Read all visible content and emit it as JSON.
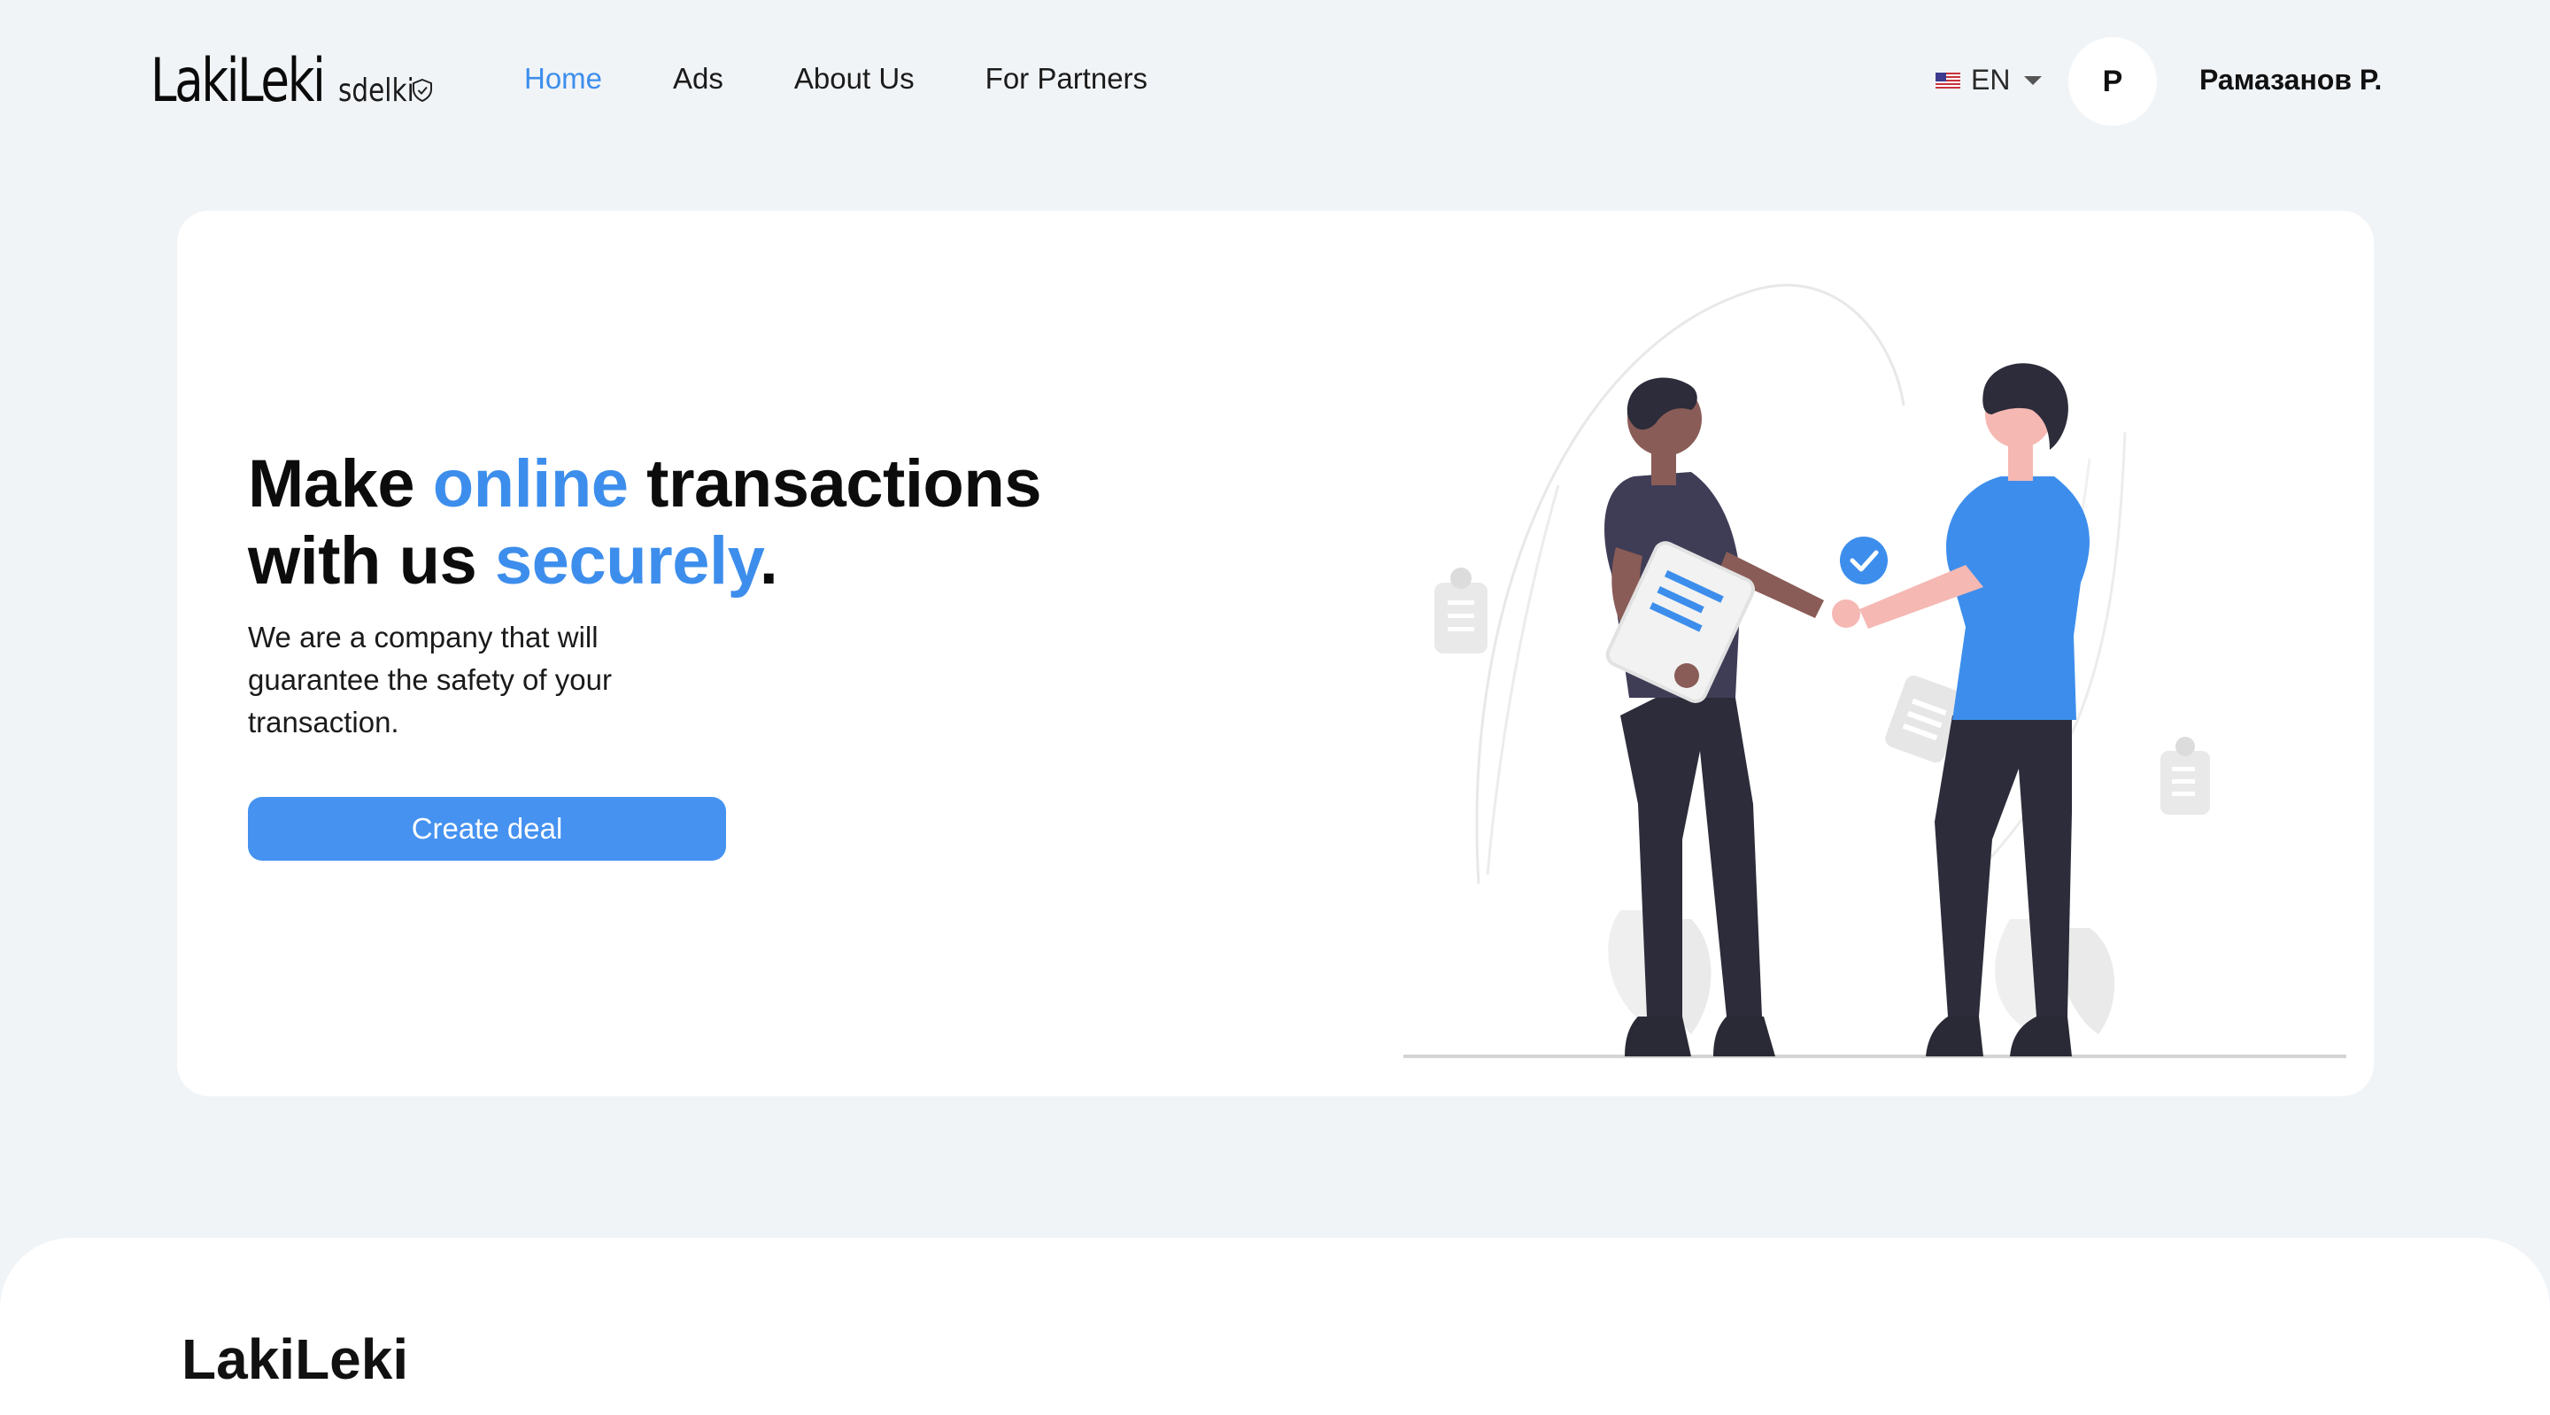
{
  "header": {
    "logo": {
      "main": "LakiLeki",
      "sub": "sdelki"
    },
    "nav": [
      {
        "label": "Home",
        "active": true
      },
      {
        "label": "Ads",
        "active": false
      },
      {
        "label": "About Us",
        "active": false
      },
      {
        "label": "For Partners",
        "active": false
      }
    ],
    "language": {
      "flag": "us-flag-icon",
      "label": "EN"
    },
    "user": {
      "avatar_initial": "P",
      "name": "Рамазанов Р."
    }
  },
  "hero": {
    "title": {
      "part1": "Make ",
      "accent1": "online",
      "part2": " transactions",
      "part3": "with us ",
      "accent2": "securely",
      "part4": "."
    },
    "subtitle": "We are a company that will guarantee the safety of your transaction.",
    "cta_label": "Create deal",
    "illustration": "handshake-illustration"
  },
  "bottom": {
    "heading": "LakiLeki"
  },
  "colors": {
    "accent": "#3d8eec",
    "button": "#4592f1",
    "background": "#f1f4f7",
    "card": "#ffffff"
  }
}
